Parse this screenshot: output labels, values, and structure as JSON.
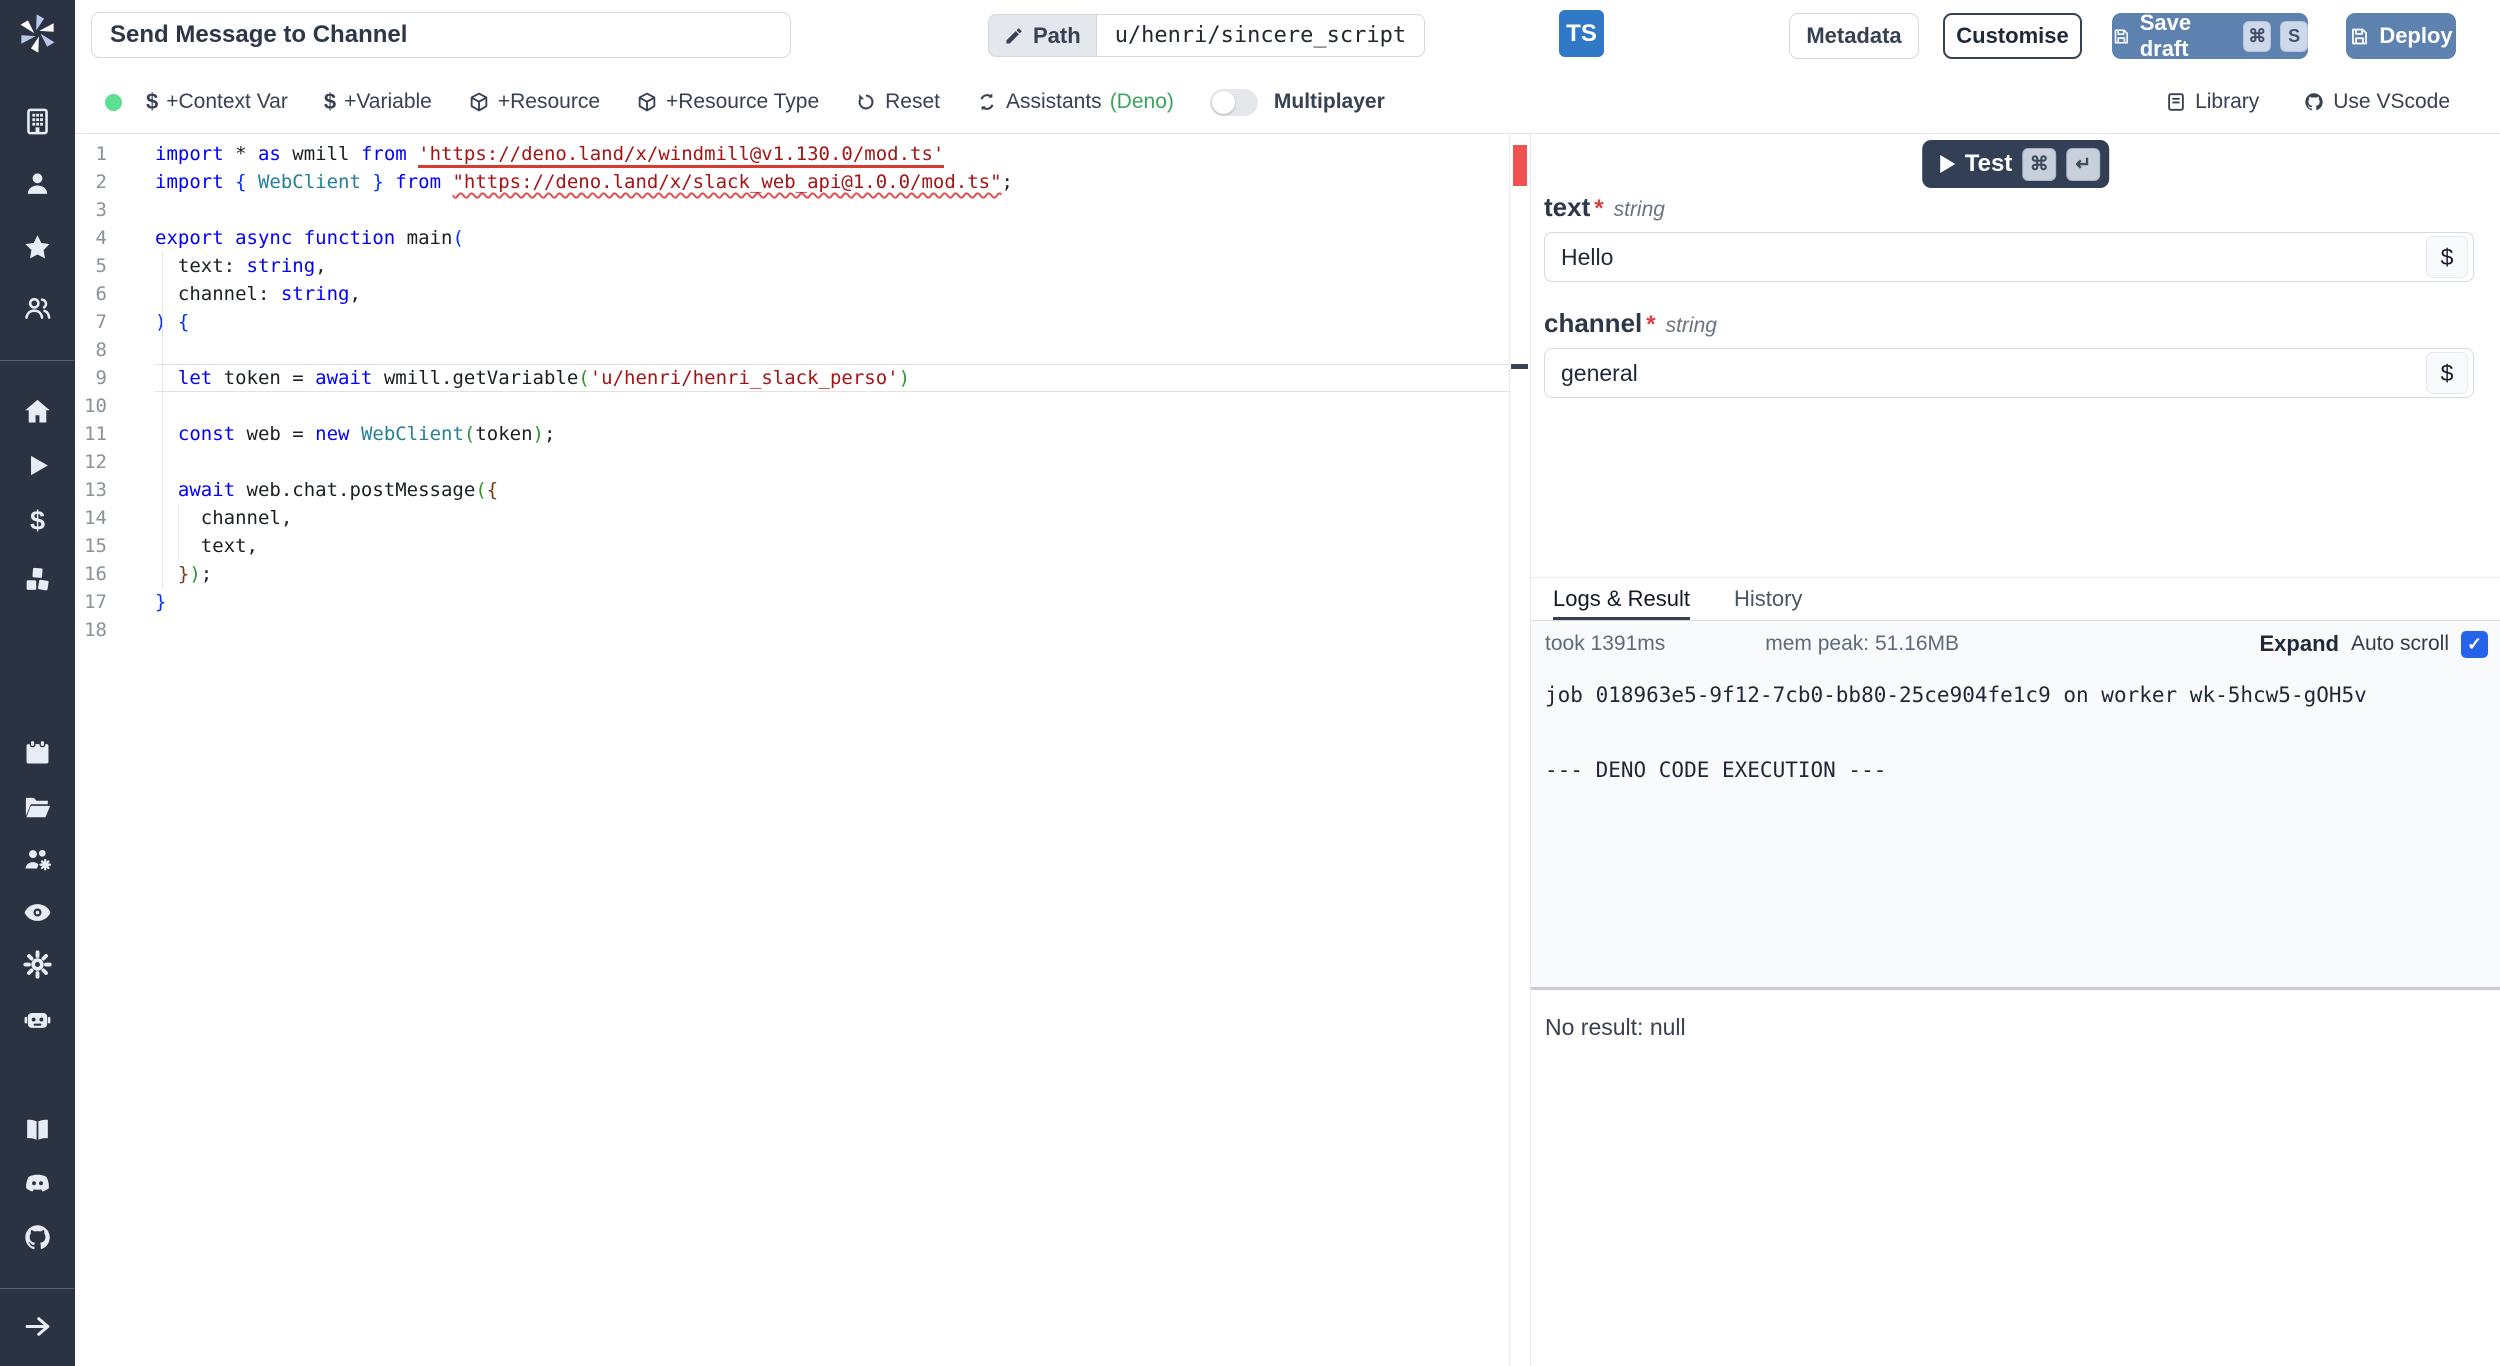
{
  "colors": {
    "sidebar_bg": "#2b3242",
    "primary_button": "#5e82b0",
    "test_button": "#333f54",
    "ts_badge": "#3178c6",
    "checkbox": "#2563eb",
    "status_dot": "#5ce08f",
    "deno_green": "#3aa55d",
    "error_marker": "#f05252"
  },
  "sidebar": {
    "icons": [
      "building",
      "user",
      "star",
      "users",
      "home",
      "play",
      "dollar",
      "cubes",
      "calendar",
      "folder",
      "users-cog",
      "eye",
      "gear",
      "robot",
      "book",
      "discord",
      "github",
      "arrow-right"
    ]
  },
  "topbar": {
    "title_value": "Send Message to Channel",
    "path_label": "Path",
    "path_value": "u/henri/sincere_script",
    "lang_badge": "TS",
    "metadata_label": "Metadata",
    "customise_label": "Customise",
    "save_draft_label": "Save draft",
    "save_kbd1": "⌘",
    "save_kbd2": "S",
    "deploy_label": "Deploy"
  },
  "toolbar": {
    "context_var": "+Context Var",
    "context_var_icon": "$",
    "variable": "+Variable",
    "variable_icon": "$",
    "resource": "+Resource",
    "resource_type": "+Resource Type",
    "reset": "Reset",
    "assistants": "Assistants",
    "assistants_suffix": "(Deno)",
    "multiplayer": "Multiplayer",
    "library": "Library",
    "vscode": "Use VScode"
  },
  "editor": {
    "current_line": 9,
    "lines": [
      [
        {
          "t": "import ",
          "c": "k"
        },
        {
          "t": "* ",
          "c": "d"
        },
        {
          "t": "as ",
          "c": "k"
        },
        {
          "t": "wmill ",
          "c": "d"
        },
        {
          "t": "from ",
          "c": "k"
        },
        {
          "t": "'https://deno.land/x/windmill@v1.130.0/mod.ts'",
          "c": "s",
          "u": "solid"
        }
      ],
      [
        {
          "t": "import ",
          "c": "k"
        },
        {
          "t": "{ ",
          "c": "bb"
        },
        {
          "t": "WebClient",
          "c": "t"
        },
        {
          "t": " }",
          "c": "bb"
        },
        {
          "t": " ",
          "c": "d"
        },
        {
          "t": "from ",
          "c": "k"
        },
        {
          "t": "\"https://deno.land/x/slack_web_api@1.0.0/mod.ts\"",
          "c": "s",
          "u": "wavy"
        },
        {
          "t": ";",
          "c": "d"
        }
      ],
      [],
      [
        {
          "t": "export ",
          "c": "k"
        },
        {
          "t": "async ",
          "c": "k"
        },
        {
          "t": "function ",
          "c": "k"
        },
        {
          "t": "main",
          "c": "d"
        },
        {
          "t": "(",
          "c": "bb"
        }
      ],
      [
        {
          "t": "  text",
          "c": "d"
        },
        {
          "t": ": ",
          "c": "d"
        },
        {
          "t": "string",
          "c": "k"
        },
        {
          "t": ",",
          "c": "d"
        }
      ],
      [
        {
          "t": "  channel",
          "c": "d"
        },
        {
          "t": ": ",
          "c": "d"
        },
        {
          "t": "string",
          "c": "k"
        },
        {
          "t": ",",
          "c": "d"
        }
      ],
      [
        {
          "t": ") ",
          "c": "bb"
        },
        {
          "t": "{",
          "c": "bb"
        }
      ],
      [],
      [
        {
          "t": "  ",
          "c": "d"
        },
        {
          "t": "let ",
          "c": "k"
        },
        {
          "t": "token = ",
          "c": "d"
        },
        {
          "t": "await ",
          "c": "k"
        },
        {
          "t": "wmill.getVariable",
          "c": "d"
        },
        {
          "t": "(",
          "c": "gb"
        },
        {
          "t": "'u/henri/henri_slack_perso'",
          "c": "s"
        },
        {
          "t": ")",
          "c": "gb"
        }
      ],
      [],
      [
        {
          "t": "  ",
          "c": "d"
        },
        {
          "t": "const ",
          "c": "k"
        },
        {
          "t": "web = ",
          "c": "d"
        },
        {
          "t": "new ",
          "c": "k"
        },
        {
          "t": "WebClient",
          "c": "t"
        },
        {
          "t": "(",
          "c": "gb"
        },
        {
          "t": "token",
          "c": "d"
        },
        {
          "t": ")",
          "c": "gb"
        },
        {
          "t": ";",
          "c": "d"
        }
      ],
      [],
      [
        {
          "t": "  ",
          "c": "d"
        },
        {
          "t": "await ",
          "c": "k"
        },
        {
          "t": "web.chat.postMessage",
          "c": "d"
        },
        {
          "t": "(",
          "c": "gb"
        },
        {
          "t": "{",
          "c": "nb"
        }
      ],
      [
        {
          "t": "    channel,",
          "c": "d"
        }
      ],
      [
        {
          "t": "    text,",
          "c": "d"
        }
      ],
      [
        {
          "t": "  ",
          "c": "d"
        },
        {
          "t": "}",
          "c": "nb"
        },
        {
          "t": ")",
          "c": "gb"
        },
        {
          "t": ";",
          "c": "d"
        }
      ],
      [
        {
          "t": "}",
          "c": "bb"
        }
      ],
      []
    ]
  },
  "right": {
    "test": {
      "label": "Test",
      "kbd1": "⌘",
      "kbd2": "↵"
    },
    "fields": [
      {
        "name": "text",
        "req": "*",
        "type": "string",
        "value": "Hello",
        "pill": "$"
      },
      {
        "name": "channel",
        "req": "*",
        "type": "string",
        "value": "general",
        "pill": "$"
      }
    ],
    "tabs": {
      "logs": "Logs & Result",
      "history": "History"
    },
    "meta": {
      "took": "took 1391ms",
      "mem": "mem peak: 51.16MB",
      "expand": "Expand",
      "autoscroll": "Auto scroll",
      "check_glyph": "✓"
    },
    "log_text": "job 018963e5-9f12-7cb0-bb80-25ce904fe1c9 on worker wk-5hcw5-gOH5v\n\n\n--- DENO CODE EXECUTION ---",
    "result": "No result: null"
  }
}
